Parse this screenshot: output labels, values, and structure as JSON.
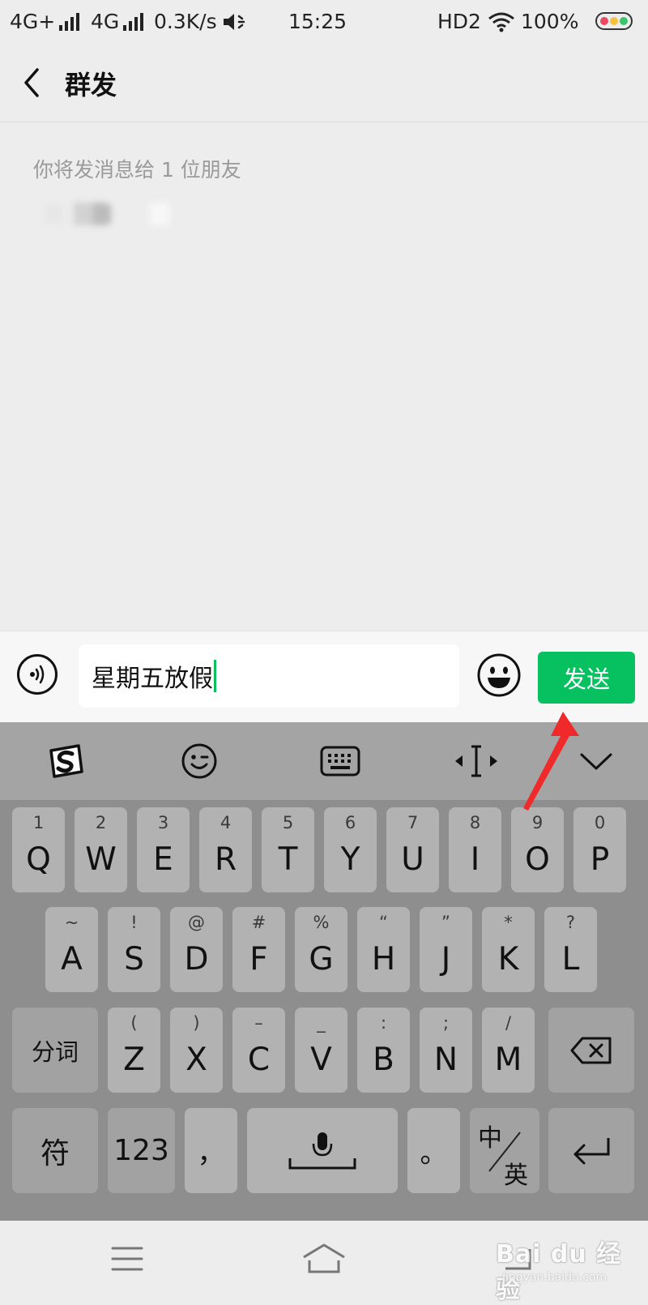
{
  "status_bar": {
    "network1": "4G+",
    "network2": "4G",
    "speed": "0.3K/s",
    "time": "15:25",
    "hd": "HD2",
    "battery": "100%",
    "icons": [
      "signal-icon",
      "mute-icon",
      "wifi-icon",
      "battery-icon"
    ]
  },
  "header": {
    "title": "群发",
    "back_icon": "chevron-left-icon"
  },
  "recipients": {
    "hint": "你将发消息给 1 位朋友"
  },
  "input_bar": {
    "value": "星期五放假",
    "send_label": "发送",
    "voice_icon": "voice-icon",
    "emoji_icon": "emoji-icon",
    "accent_color": "#07c160"
  },
  "keyboard": {
    "toolbar_icons": [
      "sogou-logo-icon",
      "wink-emoji-icon",
      "keyboard-icon",
      "cursor-move-icon",
      "collapse-keyboard-icon"
    ],
    "row1": [
      {
        "num": "1",
        "key": "Q"
      },
      {
        "num": "2",
        "key": "W"
      },
      {
        "num": "3",
        "key": "E"
      },
      {
        "num": "4",
        "key": "R"
      },
      {
        "num": "5",
        "key": "T"
      },
      {
        "num": "6",
        "key": "Y"
      },
      {
        "num": "7",
        "key": "U"
      },
      {
        "num": "8",
        "key": "I"
      },
      {
        "num": "9",
        "key": "O"
      },
      {
        "num": "0",
        "key": "P"
      }
    ],
    "row2": [
      {
        "num": "~",
        "key": "A"
      },
      {
        "num": "!",
        "key": "S"
      },
      {
        "num": "@",
        "key": "D"
      },
      {
        "num": "#",
        "key": "F"
      },
      {
        "num": "%",
        "key": "G"
      },
      {
        "num": "“",
        "key": "H"
      },
      {
        "num": "”",
        "key": "J"
      },
      {
        "num": "*",
        "key": "K"
      },
      {
        "num": "?",
        "key": "L"
      }
    ],
    "row3": [
      {
        "num": "(",
        "key": "Z"
      },
      {
        "num": ")",
        "key": "X"
      },
      {
        "num": "–",
        "key": "C"
      },
      {
        "num": "_",
        "key": "V"
      },
      {
        "num": ":",
        "key": "B"
      },
      {
        "num": ";",
        "key": "N"
      },
      {
        "num": "/",
        "key": "M"
      }
    ],
    "segment_label": "分词",
    "symbol_label": "符",
    "numeric_label": "123",
    "comma_label": "，",
    "period_label": "。",
    "lang_top": "中",
    "lang_bottom": "英"
  },
  "nav_bar": {
    "icons": [
      "menu-icon",
      "home-icon",
      "back-icon"
    ]
  },
  "watermark": {
    "brand": "Bai du 经验",
    "url": "jingyan.baidu.com"
  }
}
